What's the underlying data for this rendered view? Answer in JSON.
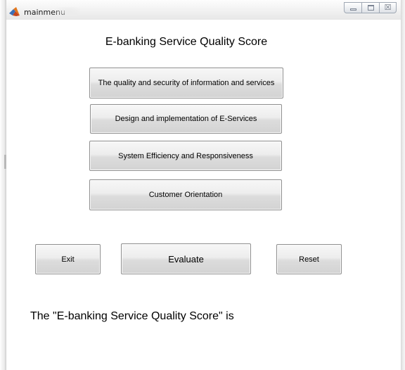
{
  "window": {
    "title": "mainmenu",
    "controls": {
      "minimize_icon": "minimize-icon",
      "maximize_icon": "maximize-icon",
      "close_glyph": "☒"
    }
  },
  "heading": "E-banking Service Quality Score",
  "category_buttons": [
    "The quality and security of information and services",
    "Design and implementation of E-Services",
    "System Efficiency and Responsiveness",
    "Customer Orientation"
  ],
  "actions": {
    "exit": "Exit",
    "evaluate": "Evaluate",
    "reset": "Reset"
  },
  "result_label": "The \"E-banking Service Quality Score\" is",
  "colors": {
    "button_border": "#8f8f8f",
    "button_face": "#e6e6e6",
    "background": "#ffffff"
  }
}
